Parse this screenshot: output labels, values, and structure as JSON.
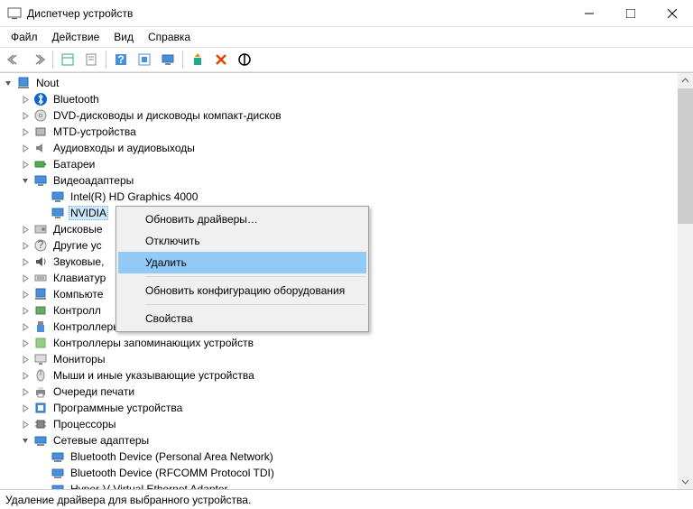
{
  "window": {
    "title": "Диспетчер устройств"
  },
  "menu": {
    "file": "Файл",
    "action": "Действие",
    "view": "Вид",
    "help": "Справка"
  },
  "root": {
    "name": "Nout"
  },
  "tree": [
    {
      "label": "Bluetooth",
      "icon": "bluetooth",
      "exp": "closed",
      "indent": 1
    },
    {
      "label": "DVD-дисководы и дисководы компакт-дисков",
      "icon": "disc",
      "exp": "closed",
      "indent": 1
    },
    {
      "label": "MTD-устройства",
      "icon": "mtd",
      "exp": "closed",
      "indent": 1
    },
    {
      "label": "Аудиовходы и аудиовыходы",
      "icon": "audio",
      "exp": "closed",
      "indent": 1
    },
    {
      "label": "Батареи",
      "icon": "battery",
      "exp": "closed",
      "indent": 1
    },
    {
      "label": "Видеоадаптеры",
      "icon": "display",
      "exp": "open",
      "indent": 1
    },
    {
      "label": "Intel(R) HD Graphics 4000",
      "icon": "display",
      "exp": "none",
      "indent": 2
    },
    {
      "label": "NVIDIA",
      "icon": "display",
      "exp": "none",
      "indent": 2,
      "selected": true
    },
    {
      "label": "Дисковые",
      "icon": "disk",
      "exp": "closed",
      "indent": 1
    },
    {
      "label": "Другие ус",
      "icon": "other",
      "exp": "closed",
      "indent": 1
    },
    {
      "label": "Звуковые,",
      "icon": "sound",
      "exp": "closed",
      "indent": 1
    },
    {
      "label": "Клавиатур",
      "icon": "keyboard",
      "exp": "closed",
      "indent": 1
    },
    {
      "label": "Компьюте",
      "icon": "computer",
      "exp": "closed",
      "indent": 1
    },
    {
      "label": "Контролл",
      "icon": "controller",
      "exp": "closed",
      "indent": 1
    },
    {
      "label": "Контроллеры USB",
      "icon": "usb",
      "exp": "closed",
      "indent": 1
    },
    {
      "label": "Контроллеры запоминающих устройств",
      "icon": "storage",
      "exp": "closed",
      "indent": 1
    },
    {
      "label": "Мониторы",
      "icon": "monitor",
      "exp": "closed",
      "indent": 1
    },
    {
      "label": "Мыши и иные указывающие устройства",
      "icon": "mouse",
      "exp": "closed",
      "indent": 1
    },
    {
      "label": "Очереди печати",
      "icon": "printer",
      "exp": "closed",
      "indent": 1
    },
    {
      "label": "Программные устройства",
      "icon": "software",
      "exp": "closed",
      "indent": 1
    },
    {
      "label": "Процессоры",
      "icon": "cpu",
      "exp": "closed",
      "indent": 1
    },
    {
      "label": "Сетевые адаптеры",
      "icon": "network",
      "exp": "open",
      "indent": 1
    },
    {
      "label": "Bluetooth Device (Personal Area Network)",
      "icon": "network",
      "exp": "none",
      "indent": 2
    },
    {
      "label": "Bluetooth Device (RFCOMM Protocol TDI)",
      "icon": "network",
      "exp": "none",
      "indent": 2
    },
    {
      "label": "Hyper-V Virtual Ethernet Adapter",
      "icon": "network",
      "exp": "none",
      "indent": 2
    }
  ],
  "context": {
    "update": "Обновить драйверы…",
    "disable": "Отключить",
    "delete": "Удалить",
    "refresh": "Обновить конфигурацию оборудования",
    "props": "Свойства"
  },
  "status": "Удаление драйвера для выбранного устройства."
}
